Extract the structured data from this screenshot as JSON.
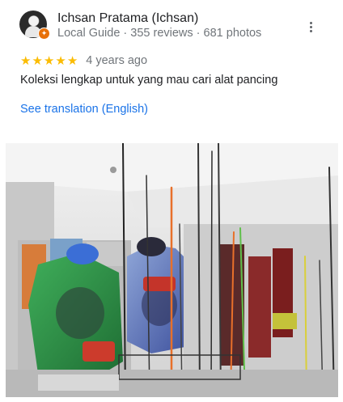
{
  "review": {
    "reviewer_name": "Ichsan Pratama (Ichsan)",
    "reviewer_meta": "Local Guide · 355 reviews · 681 photos",
    "rating": 5,
    "star_glyph": "★",
    "date": "4 years ago",
    "text": "Koleksi lengkap untuk yang mau cari alat pancing",
    "translate_label": "See translation (English)"
  },
  "icons": {
    "avatar": "user-avatar",
    "badge": "local-guide-badge",
    "more": "more-vert-icon",
    "star": "star-icon"
  },
  "colors": {
    "star": "#fbbc04",
    "link": "#1a73e8",
    "secondary_text": "#70757a",
    "badge": "#e8710a"
  }
}
